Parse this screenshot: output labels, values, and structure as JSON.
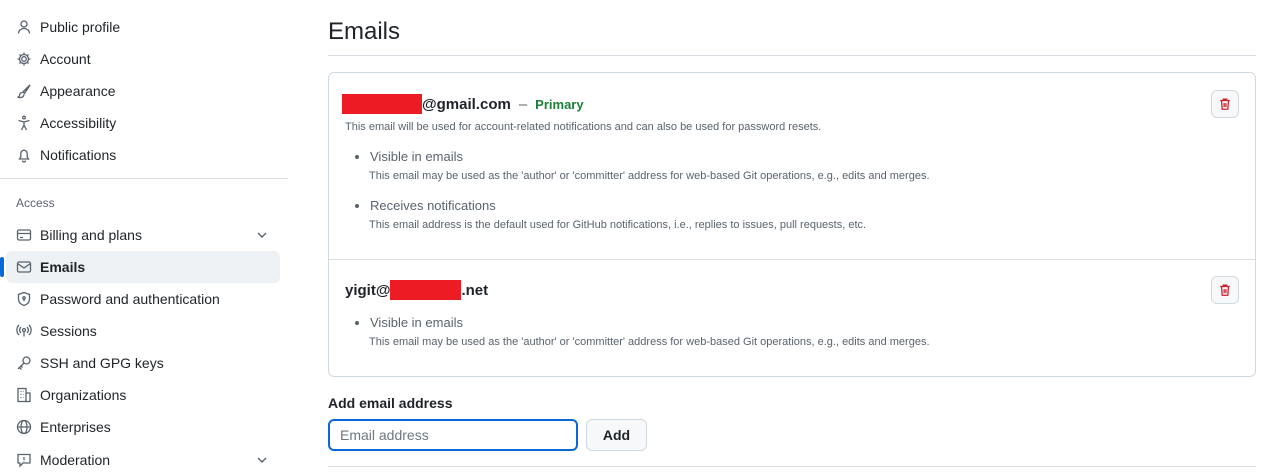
{
  "sidebar": {
    "items": [
      {
        "label": "Public profile",
        "icon": "person-icon"
      },
      {
        "label": "Account",
        "icon": "gear-icon"
      },
      {
        "label": "Appearance",
        "icon": "paintbrush-icon"
      },
      {
        "label": "Accessibility",
        "icon": "accessibility-icon"
      },
      {
        "label": "Notifications",
        "icon": "bell-icon"
      }
    ],
    "access_heading": "Access",
    "access_items": [
      {
        "label": "Billing and plans",
        "icon": "credit-card-icon"
      },
      {
        "label": "Emails",
        "icon": "mail-icon"
      },
      {
        "label": "Password and authentication",
        "icon": "shield-lock-icon"
      },
      {
        "label": "Sessions",
        "icon": "broadcast-icon"
      },
      {
        "label": "SSH and GPG keys",
        "icon": "key-icon"
      },
      {
        "label": "Organizations",
        "icon": "organization-icon"
      },
      {
        "label": "Enterprises",
        "icon": "globe-icon"
      },
      {
        "label": "Moderation",
        "icon": "report-icon"
      }
    ],
    "active": "Emails"
  },
  "main": {
    "title": "Emails",
    "emails": [
      {
        "suffix": "@gmail.com",
        "separator": "–",
        "badge": "Primary",
        "description": "This email will be used for account-related notifications and can also be used for password resets.",
        "bullets": [
          {
            "title": "Visible in emails",
            "desc": "This email may be used as the 'author' or 'committer' address for web-based Git operations, e.g., edits and merges."
          },
          {
            "title": "Receives notifications",
            "desc": "This email address is the default used for GitHub notifications, i.e., replies to issues, pull requests, etc."
          }
        ]
      },
      {
        "prefix": "yigit@",
        "suffix": ".net",
        "bullets": [
          {
            "title": "Visible in emails",
            "desc": "This email may be used as the 'author' or 'committer' address for web-based Git operations, e.g., edits and merges."
          }
        ]
      }
    ],
    "add_email": {
      "label": "Add email address",
      "placeholder": "Email address",
      "button": "Add"
    }
  },
  "colors": {
    "accent": "#0969da",
    "primary_badge": "#1a7f37",
    "danger": "#cf222e",
    "redaction": "#ed1c24"
  }
}
